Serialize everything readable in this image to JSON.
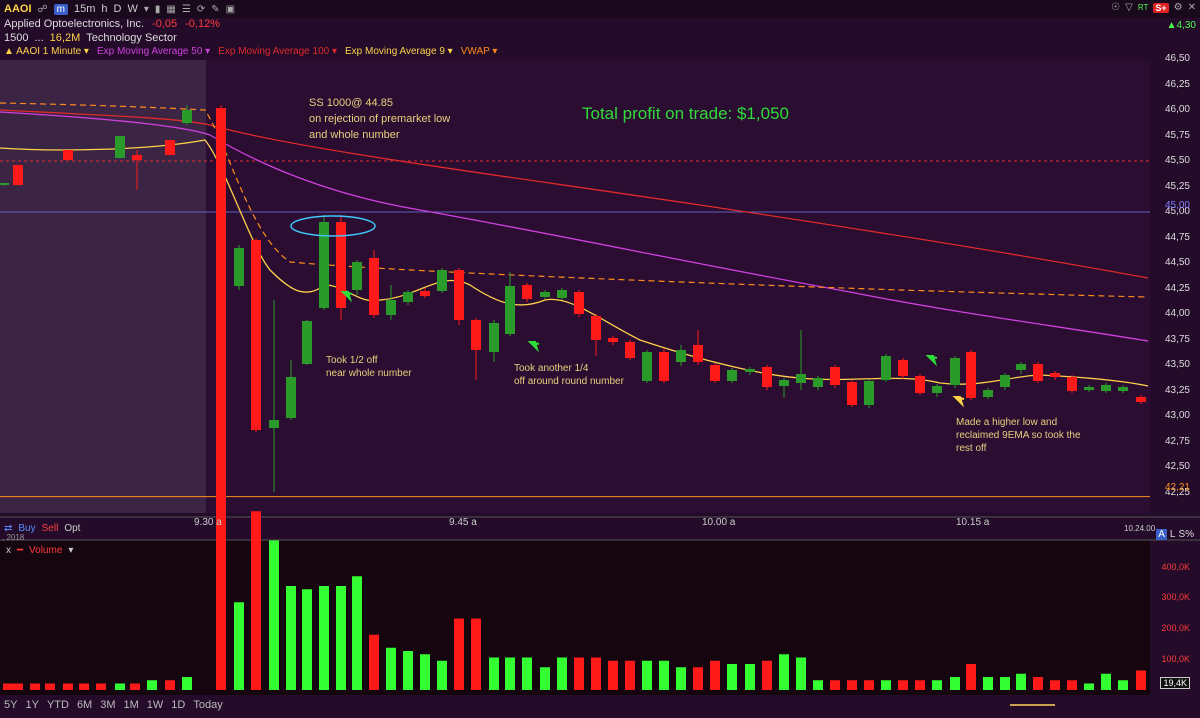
{
  "toolbar": {
    "symbol": "AAOI",
    "timeframe": "15m",
    "tf_h": "h",
    "tf_d": "D",
    "tf_w": "W",
    "m_button": "m",
    "tr_label": "RT",
    "s_badge": "S+"
  },
  "quote": {
    "name": "Applied Optoelectronics, Inc.",
    "change": "-0,05",
    "change_pct": "-0,12%",
    "last": "4,30",
    "time": "1500",
    "dots": "...",
    "volume": "16,2M",
    "sector": "Technology Sector"
  },
  "studies": [
    {
      "label": "AAOI 1 Minute",
      "color": "#ffd24a"
    },
    {
      "label": "Exp Moving Average 50",
      "color": "#d040e0"
    },
    {
      "label": "Exp Moving Average 100",
      "color": "#e02a2a"
    },
    {
      "label": "Exp Moving Average 9",
      "color": "#ffd24a"
    },
    {
      "label": "VWAP",
      "color": "#ff8c1a"
    }
  ],
  "annotations": {
    "ss_line1": "SS 1000@ 44.85",
    "ss_line2": "on rejection of premarket low",
    "ss_line3": "and whole number",
    "profit": "Total profit on trade: $1,050",
    "half_line1": "Took 1/2 off",
    "half_line2": "near whole number",
    "quarter_line1": "Took another 1/4",
    "quarter_line2": "off around round number",
    "last_line1": "Made a higher low and",
    "last_line2": "reclaimed 9EMA so took the",
    "last_line3": "rest off"
  },
  "price_axis": [
    "46,50",
    "46,25",
    "46,00",
    "45,75",
    "45,50",
    "45,25",
    "45,00",
    "44,75",
    "44,50",
    "44,25",
    "44,00",
    "43,75",
    "43,50",
    "43,25",
    "43,00",
    "42,75",
    "42,50",
    "42,25"
  ],
  "level_labels": {
    "whole": "45,00",
    "low": "42,21"
  },
  "time_axis": [
    "9.30 a",
    "9.45 a",
    "10.00 a",
    "10.15 a"
  ],
  "cursor_time": "10.24.00",
  "trade_buttons": {
    "buy": "Buy",
    "sell": "Sell",
    "opt": "Opt"
  },
  "right_controls": {
    "a": "A",
    "l": "L",
    "s": "S%"
  },
  "volume": {
    "title": "Volume",
    "x": "x",
    "axis": [
      "400,0K",
      "300,0K",
      "200,0K",
      "100,0K"
    ],
    "current": "19,4K",
    "stray": ", 2018"
  },
  "ranges": [
    "5Y",
    "1Y",
    "YTD",
    "6M",
    "3M",
    "1M",
    "1W",
    "1D",
    "Today"
  ],
  "colors": {
    "up": "#1a7a1a",
    "down": "#ff1a1a",
    "ema9": "#ffd24a",
    "ema50": "#d040e0",
    "ema100": "#e02a2a",
    "vwap": "#ff8c1a",
    "vol_up": "#33ff33",
    "vol_down": "#ff1a1a"
  },
  "chart_data": {
    "type": "candlestick",
    "ylim": [
      42.0,
      46.7
    ],
    "candles": [
      {
        "o": 45.22,
        "h": 45.27,
        "l": 45.2,
        "c": 45.25
      },
      {
        "o": 45.45,
        "h": 45.47,
        "l": 45.2,
        "c": 45.25
      },
      {
        "o": 45.55,
        "h": 45.6,
        "l": 45.5,
        "c": 45.55
      },
      {
        "o": 45.55,
        "h": 45.75,
        "l": 45.5,
        "c": 45.55
      },
      {
        "o": 45.55,
        "h": 45.58,
        "l": 45.5,
        "c": 45.55
      },
      {
        "o": 45.52,
        "h": 45.55,
        "l": 45.5,
        "c": 45.52
      },
      {
        "o": 45.55,
        "h": 45.6,
        "l": 45.5,
        "c": 45.55
      },
      {
        "o": 45.55,
        "h": 45.6,
        "l": 45.5,
        "c": 45.55
      },
      {
        "o": 45.55,
        "h": 45.6,
        "l": 45.5,
        "c": 45.55
      },
      {
        "o": 45.55,
        "h": 45.6,
        "l": 45.5,
        "c": 45.55
      },
      {
        "o": 45.55,
        "h": 45.85,
        "l": 45.5,
        "c": 45.8
      },
      {
        "o": 45.55,
        "h": 45.6,
        "l": 45.25,
        "c": 45.52
      },
      {
        "o": 45.55,
        "h": 45.6,
        "l": 45.5,
        "c": 45.55
      },
      {
        "o": 45.55,
        "h": 45.6,
        "l": 45.5,
        "c": 45.55
      },
      {
        "o": 45.7,
        "h": 45.72,
        "l": 45.5,
        "c": 45.52
      },
      {
        "o": 45.55,
        "h": 45.6,
        "l": 45.5,
        "c": 45.55
      },
      {
        "o": 45.55,
        "h": 45.6,
        "l": 45.5,
        "c": 45.55
      },
      {
        "o": 45.55,
        "h": 45.6,
        "l": 45.5,
        "c": 45.55
      },
      {
        "o": 45.55,
        "h": 45.6,
        "l": 45.5,
        "c": 45.55
      },
      {
        "o": 45.55,
        "h": 45.6,
        "l": 45.5,
        "c": 45.55
      },
      {
        "o": 45.55,
        "h": 45.6,
        "l": 45.5,
        "c": 45.55
      },
      {
        "o": 45.55,
        "h": 45.6,
        "l": 45.5,
        "c": 45.55
      },
      {
        "o": 45.55,
        "h": 45.6,
        "l": 45.5,
        "c": 45.55
      },
      {
        "o": 45.95,
        "h": 46.25,
        "l": 45.9,
        "c": 46.0
      }
    ]
  }
}
